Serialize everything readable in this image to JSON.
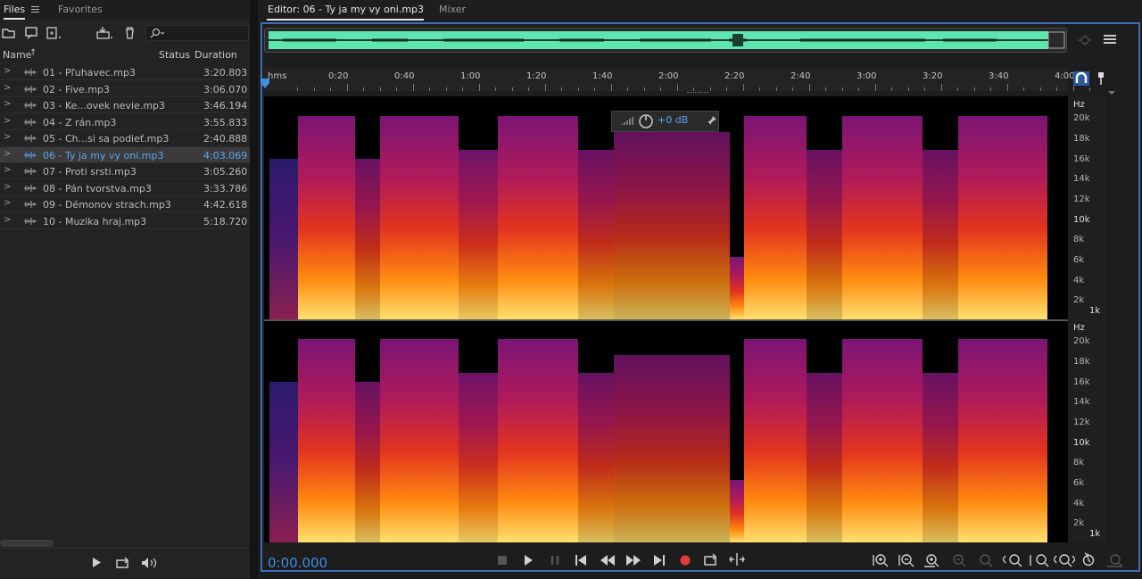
{
  "files_panel": {
    "tab_files": "Files",
    "tab_favorites": "Favorites",
    "col_name": "Name",
    "col_status": "Status",
    "col_duration": "Duration",
    "items": [
      {
        "name": "01 - Pľuhavec.mp3",
        "duration": "3:20.803"
      },
      {
        "name": "02 - Five.mp3",
        "duration": "3:06.070"
      },
      {
        "name": "03 - Ke...ovek nevie.mp3",
        "duration": "3:46.194"
      },
      {
        "name": "04 - Z rán.mp3",
        "duration": "3:55.833"
      },
      {
        "name": "05 - Ch...si sa podieť.mp3",
        "duration": "2:40.888"
      },
      {
        "name": "06 - Ty ja my vy oni.mp3",
        "duration": "4:03.069"
      },
      {
        "name": "07 - Proti srsti.mp3",
        "duration": "3:05.260"
      },
      {
        "name": "08 - Pán tvorstva.mp3",
        "duration": "3:33.786"
      },
      {
        "name": "09 - Démonov strach.mp3",
        "duration": "4:42.618"
      },
      {
        "name": "10 - Muzika hraj.mp3",
        "duration": "5:18.720"
      }
    ],
    "selected_index": 5
  },
  "editor": {
    "tab_editor": "Editor: 06 - Ty ja my vy oni.mp3",
    "tab_mixer": "Mixer",
    "ruler_labels": [
      "hms",
      "0:20",
      "0:40",
      "1:00",
      "1:20",
      "1:40",
      "2:00",
      "2:20",
      "2:40",
      "3:00",
      "3:20",
      "3:40",
      "4:00"
    ],
    "hz_labels": [
      "Hz",
      "20k",
      "18k",
      "16k",
      "14k",
      "12k",
      "10k",
      "8k",
      "6k",
      "4k",
      "2k",
      "1k"
    ],
    "gain_value": "+0 dB",
    "timecode": "0:00.000"
  },
  "colors": {
    "accent": "#3c8fe6",
    "overview_wave": "#5fe6b0",
    "record": "#e63b3b"
  },
  "icons": [
    "open-folder-icon",
    "import-icon",
    "new-file-icon",
    "insert-icon",
    "trash-icon",
    "search-icon",
    "play-icon",
    "loop-icon",
    "volume-icon",
    "stop-icon",
    "pause-icon",
    "skip-back-icon",
    "rewind-icon",
    "fast-forward-icon",
    "skip-forward-icon",
    "record-icon",
    "zoom-in-icon",
    "zoom-out-icon"
  ]
}
